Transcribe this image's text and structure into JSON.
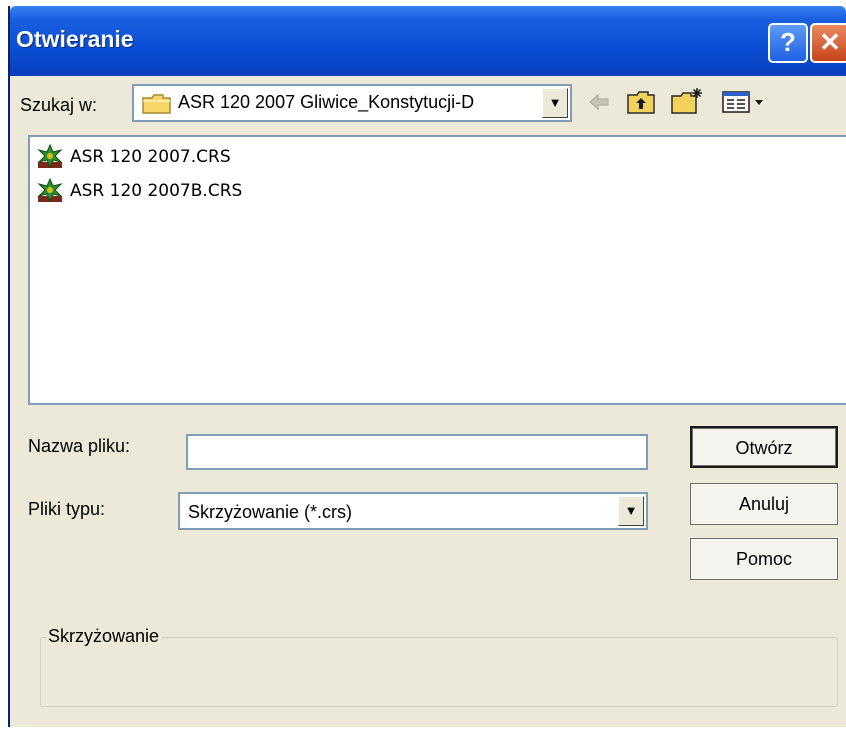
{
  "window": {
    "title": "Otwieranie"
  },
  "look_in": {
    "label": "Szukaj w:",
    "value": "ASR 120 2007 Gliwice_Konstytucji-D",
    "icon": "folder-icon"
  },
  "toolbar": {
    "back_icon": "back-arrow-icon",
    "up_icon": "up-folder-icon",
    "new_folder_icon": "new-folder-icon",
    "view_icon": "view-menu-icon"
  },
  "files": [
    {
      "name": "ASR 120 2007.CRS",
      "icon": "crs-file-icon"
    },
    {
      "name": "ASR 120 2007B.CRS",
      "icon": "crs-file-icon"
    }
  ],
  "file_name": {
    "label": "Nazwa pliku:",
    "value": ""
  },
  "file_type": {
    "label": "Pliki typu:",
    "value": "Skrzyżowanie (*.crs)"
  },
  "buttons": {
    "open": "Otwórz",
    "cancel": "Anuluj",
    "help": "Pomoc"
  },
  "group": {
    "legend": "Skrzyżowanie"
  },
  "colors": {
    "title_bar": "#0a4ed4",
    "dialog_bg": "#ece9d8",
    "close_button": "#c8431a"
  }
}
